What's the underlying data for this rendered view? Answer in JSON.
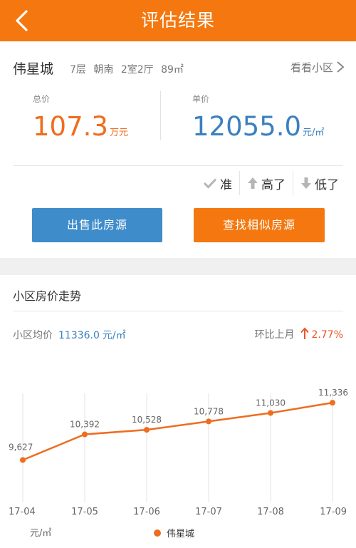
{
  "header": {
    "title": "评估结果"
  },
  "estate": {
    "name": "伟星城",
    "floor": "7层",
    "orientation": "朝南",
    "layout": "2室2厅",
    "area": "89㎡",
    "view_link": "看看小区"
  },
  "prices": {
    "total_label": "总价",
    "total_value": "107.3",
    "total_unit": "万元",
    "unit_label": "单价",
    "unit_value": "12055.0",
    "unit_unit": "元/㎡"
  },
  "feedback": {
    "accurate": "准",
    "too_high": "高了",
    "too_low": "低了"
  },
  "actions": {
    "sell": "出售此房源",
    "find_similar": "查找相似房源"
  },
  "trend": {
    "title": "小区房价走势",
    "avg_label": "小区均价",
    "avg_value": "11336.0",
    "avg_unit": "元/㎡",
    "mom_label": "环比上月",
    "mom_value": "2.77%",
    "mom_direction": "up"
  },
  "colors": {
    "accent": "#f4780f",
    "blue": "#3f8ccb",
    "line": "#ee6d1e"
  },
  "chart_data": {
    "type": "line",
    "categories": [
      "17-04",
      "17-05",
      "17-06",
      "17-07",
      "17-08",
      "17-09"
    ],
    "series": [
      {
        "name": "伟星城",
        "values": [
          9627,
          10392,
          10528,
          10778,
          11030,
          11336
        ]
      }
    ],
    "data_labels": [
      "9,627",
      "10,392",
      "10,528",
      "10,778",
      "11,030",
      "11,336"
    ],
    "ylabel": "元/㎡",
    "legend": "bottom",
    "grid": "vertical"
  }
}
